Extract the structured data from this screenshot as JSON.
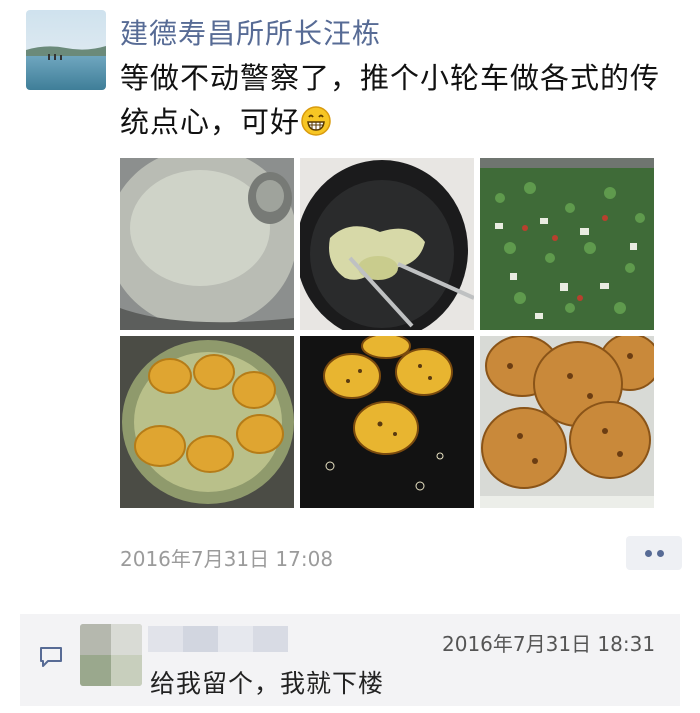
{
  "post": {
    "author": "建德寿昌所所长汪栋",
    "text": "等做不动警察了，推个小轮车做各式的传统点心，可好",
    "emoji": "grin-emoji",
    "timestamp": "2016年7月31日 17:08",
    "photos": [
      "batter-bowl",
      "frying-batter",
      "chopped-greens",
      "frying-cakes-pot",
      "frying-cakes-oil",
      "finished-cakes"
    ]
  },
  "comment": {
    "author": "",
    "time": "2016年7月31日 18:31",
    "text": "给我留个，我就下楼"
  },
  "icons": {
    "more": "more-dots-icon",
    "comment": "comment-bubble-icon"
  },
  "colors": {
    "name_link": "#576b95",
    "timestamp": "#9b9b9b",
    "comment_bg": "#f3f3f5"
  }
}
